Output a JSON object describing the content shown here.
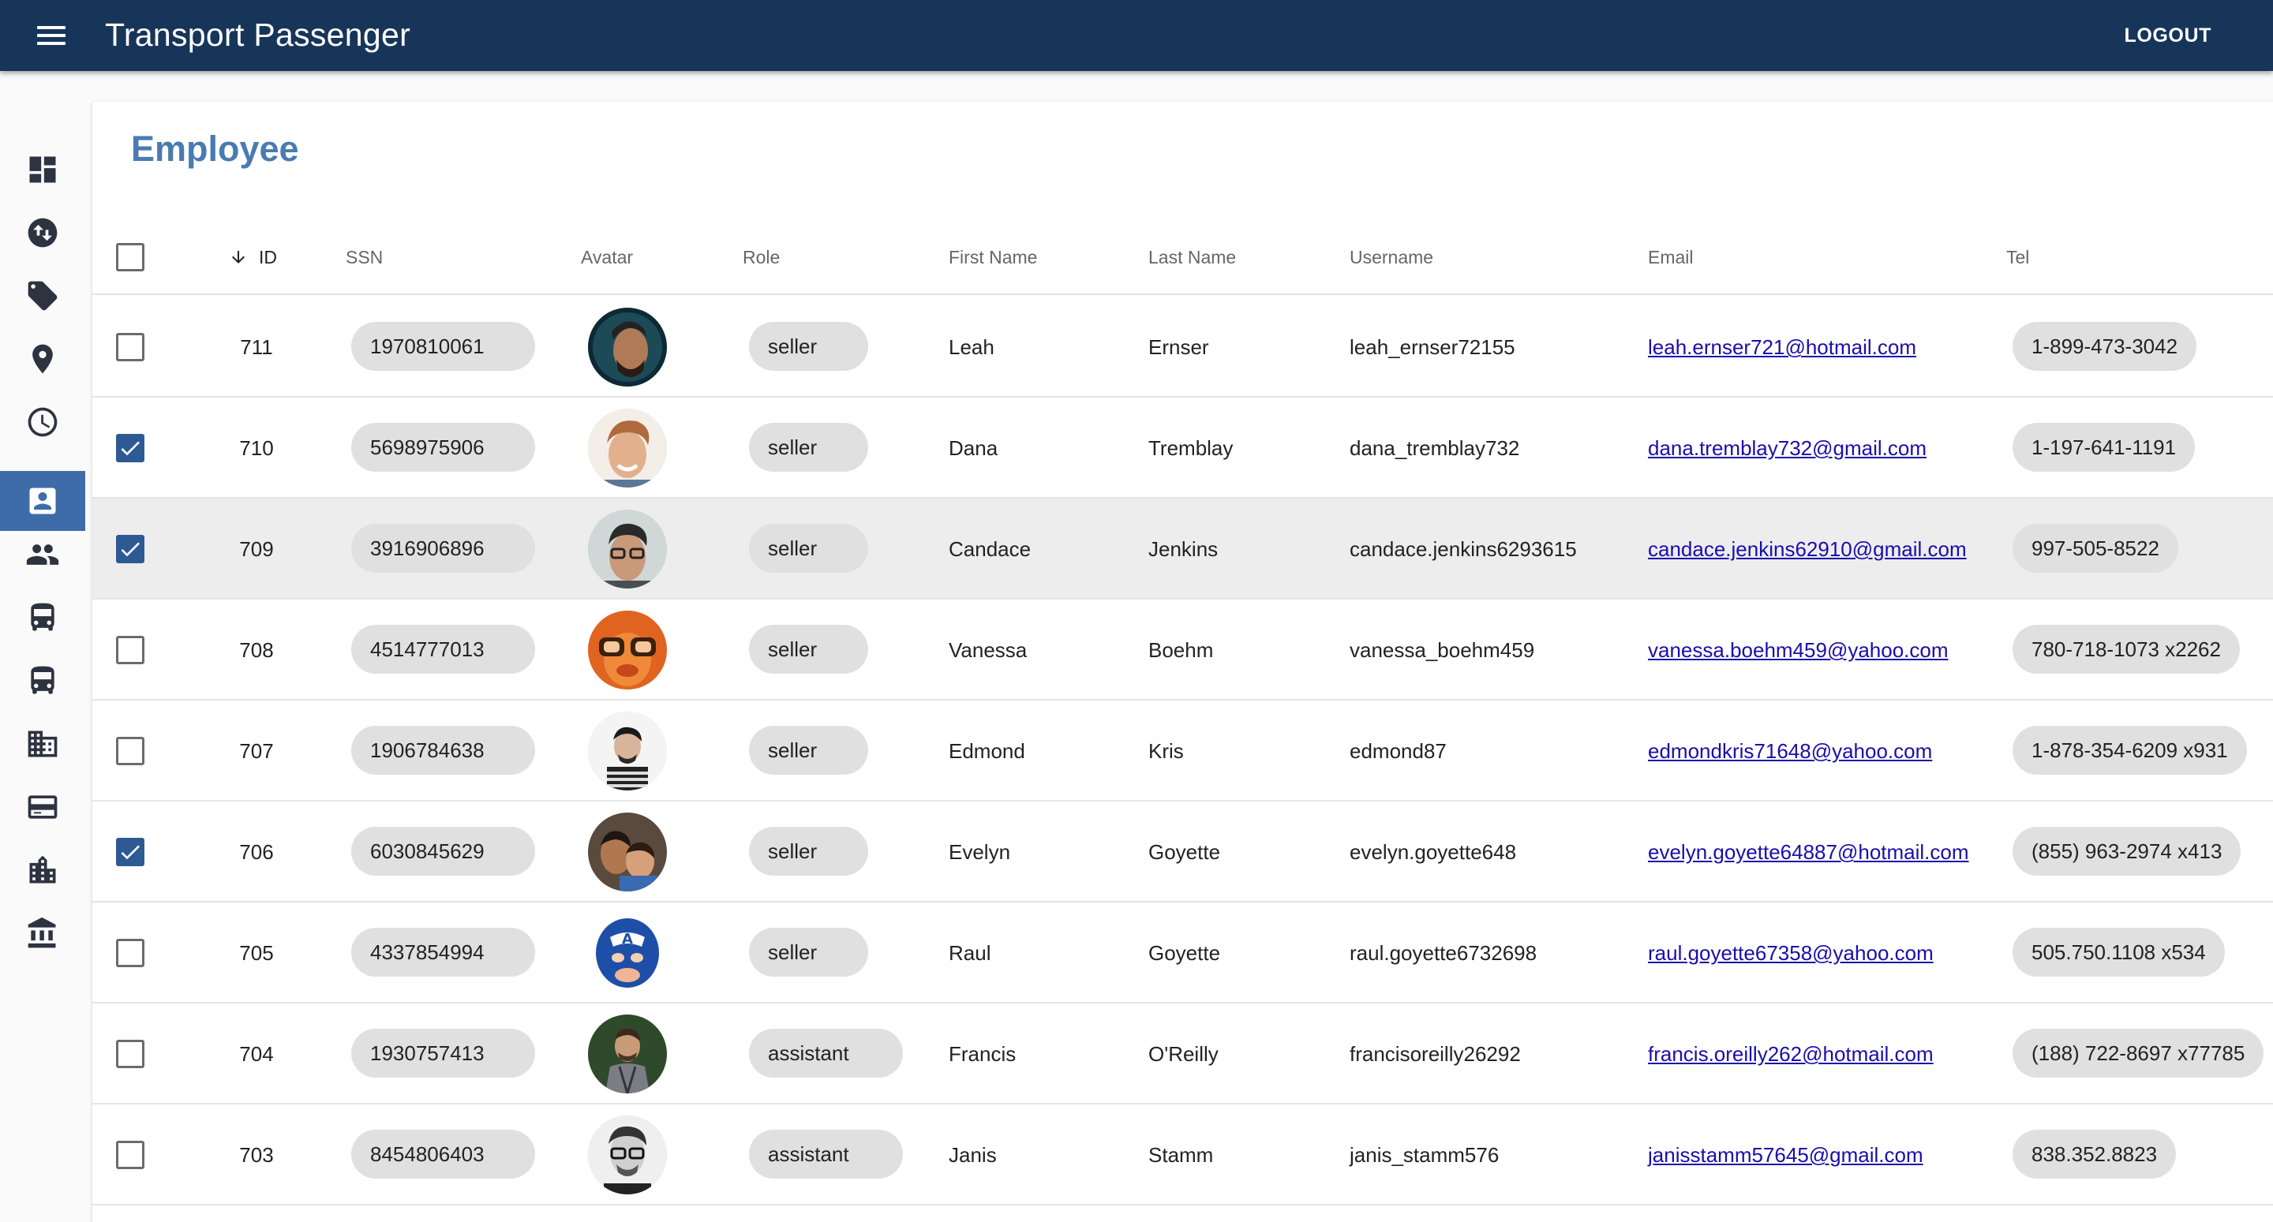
{
  "app": {
    "title": "Transport Passenger",
    "logout_label": "LOGOUT",
    "bar_color": "#173559",
    "accent_color": "#3d6ca8"
  },
  "sidebar": {
    "items": [
      {
        "icon": "dashboard-icon",
        "active": false
      },
      {
        "icon": "swap-vertical-icon",
        "active": false
      },
      {
        "icon": "tag-icon",
        "active": false
      },
      {
        "icon": "location-pin-icon",
        "active": false
      },
      {
        "icon": "clock-icon",
        "active": false
      },
      {
        "icon": "contact-card-icon",
        "active": true
      },
      {
        "icon": "people-icon",
        "active": false
      },
      {
        "icon": "bus-front-icon",
        "active": false
      },
      {
        "icon": "bus-icon",
        "active": false
      },
      {
        "icon": "building-icon",
        "active": false
      },
      {
        "icon": "card-icon",
        "active": false
      },
      {
        "icon": "city-icon",
        "active": false
      },
      {
        "icon": "bank-icon",
        "active": false
      }
    ]
  },
  "page": {
    "title": "Employee",
    "columns": {
      "id": "ID",
      "ssn": "SSN",
      "avatar": "Avatar",
      "role": "Role",
      "first_name": "First Name",
      "last_name": "Last Name",
      "username": "Username",
      "email": "Email",
      "tel": "Tel"
    },
    "rows": [
      {
        "checked": false,
        "id": "711",
        "ssn": "1970810061",
        "role": "seller",
        "first_name": "Leah",
        "last_name": "Ernser",
        "username": "leah_ernser72155",
        "email": "leah.ernser721@hotmail.com",
        "tel": "1-899-473-3042"
      },
      {
        "checked": true,
        "id": "710",
        "ssn": "5698975906",
        "role": "seller",
        "first_name": "Dana",
        "last_name": "Tremblay",
        "username": "dana_tremblay732",
        "email": "dana.tremblay732@gmail.com",
        "tel": "1-197-641-1191"
      },
      {
        "checked": true,
        "id": "709",
        "ssn": "3916906896",
        "role": "seller",
        "first_name": "Candace",
        "last_name": "Jenkins",
        "username": "candace.jenkins6293615",
        "email": "candace.jenkins62910@gmail.com",
        "tel": "997-505-8522"
      },
      {
        "checked": false,
        "id": "708",
        "ssn": "4514777013",
        "role": "seller",
        "first_name": "Vanessa",
        "last_name": "Boehm",
        "username": "vanessa_boehm459",
        "email": "vanessa.boehm459@yahoo.com",
        "tel": "780-718-1073 x2262"
      },
      {
        "checked": false,
        "id": "707",
        "ssn": "1906784638",
        "role": "seller",
        "first_name": "Edmond",
        "last_name": "Kris",
        "username": "edmond87",
        "email": "edmondkris71648@yahoo.com",
        "tel": "1-878-354-6209 x931"
      },
      {
        "checked": true,
        "id": "706",
        "ssn": "6030845629",
        "role": "seller",
        "first_name": "Evelyn",
        "last_name": "Goyette",
        "username": "evelyn.goyette648",
        "email": "evelyn.goyette64887@hotmail.com",
        "tel": "(855) 963-2974 x413"
      },
      {
        "checked": false,
        "id": "705",
        "ssn": "4337854994",
        "role": "seller",
        "first_name": "Raul",
        "last_name": "Goyette",
        "username": "raul.goyette6732698",
        "email": "raul.goyette67358@yahoo.com",
        "tel": "505.750.1108 x534"
      },
      {
        "checked": false,
        "id": "704",
        "ssn": "1930757413",
        "role": "assistant",
        "first_name": "Francis",
        "last_name": "O'Reilly",
        "username": "francisoreilly26292",
        "email": "francis.oreilly262@hotmail.com",
        "tel": "(188) 722-8697 x77785"
      },
      {
        "checked": false,
        "id": "703",
        "ssn": "8454806403",
        "role": "assistant",
        "first_name": "Janis",
        "last_name": "Stamm",
        "username": "janis_stamm576",
        "email": "janisstamm57645@gmail.com",
        "tel": "838.352.8823"
      }
    ]
  }
}
